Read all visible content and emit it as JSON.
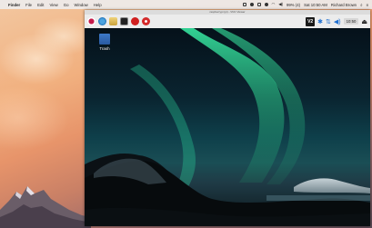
{
  "menubar": {
    "apple_glyph": "",
    "items": [
      "Finder",
      "File",
      "Edit",
      "View",
      "Go",
      "Window",
      "Help"
    ],
    "status_text": "99% (4)",
    "clock": "Sat 10:50 AM",
    "user": "Richard Brown"
  },
  "vnc": {
    "title": "raspberrypi (pi) - VNC Viewer",
    "panel": {
      "clock": "10:50",
      "vc_label": "V2"
    },
    "desktop": {
      "trash_label": "Trash"
    }
  }
}
